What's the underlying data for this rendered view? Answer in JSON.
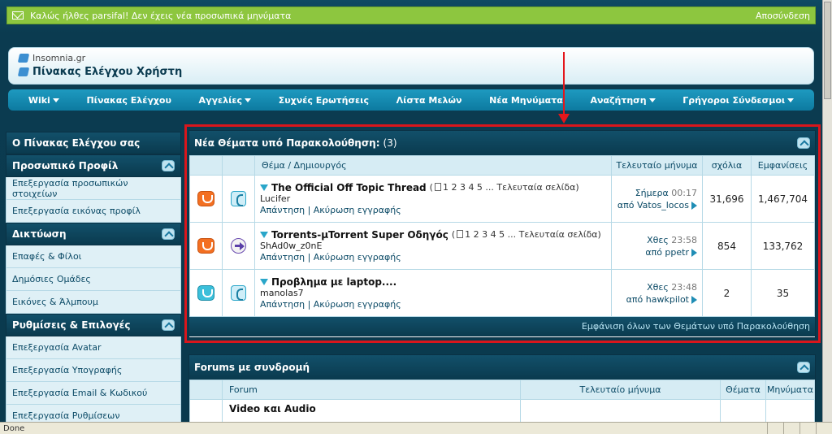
{
  "notice": {
    "message": "Καλώς ήλθες parsifal! Δεν έχεις νέα προσωπικά μηνύματα",
    "logout": "Αποσύνδεση"
  },
  "header": {
    "site": "Insomnia.gr",
    "title": "Πίνακας Ελέγχου Χρήστη"
  },
  "nav": [
    "Wiki",
    "Πίνακας Ελέγχου",
    "Αγγελίες",
    "Συχνές Ερωτήσεις",
    "Λίστα Μελών",
    "Νέα Μηνύματα",
    "Αναζήτηση",
    "Γρήγοροι Σύνδεσμοι"
  ],
  "sidebar": {
    "title": "Ο Πίνακας Ελέγχου σας",
    "sections": [
      {
        "title": "Προσωπικό Προφίλ",
        "items": [
          "Επεξεργασία προσωπικών στοιχείων",
          "Επεξεργασία εικόνας προφίλ"
        ]
      },
      {
        "title": "Δικτύωση",
        "items": [
          "Επαφές & Φίλοι",
          "Δημόσιες Ομάδες",
          "Εικόνες & Άλμπουμ"
        ]
      },
      {
        "title": "Ρυθμίσεις & Επιλογές",
        "items": [
          "Επεξεργασία Avatar",
          "Επεξεργασία Υπογραφής",
          "Επεξεργασία Email & Κωδικού",
          "Επεξεργασία Ρυθμίσεων"
        ]
      }
    ]
  },
  "subscribed": {
    "title": "Νέα Θέματα υπό Παρακολούθηση:",
    "count": "(3)",
    "columns": {
      "thread": "Θέμα / Δημιουργός",
      "last": "Τελευταίο μήνυμα",
      "replies": "σχόλια",
      "views": "Εμφανίσεις"
    },
    "threads": [
      {
        "title": "The Official Off Topic Thread",
        "pages_prefix": "(",
        "pages": "1 2 3 4 5 ... Τελευταία σελίδα)",
        "author": "Lucifer",
        "actions": "Απάντηση | Ακύρωση εγγραφής",
        "last_day": "Σήμερα",
        "last_time": "00:17",
        "last_by": "από Vatos_locos",
        "replies": "31,696",
        "views": "1,467,704"
      },
      {
        "title": "Torrents-µTorrent Super Οδηγός",
        "pages_prefix": "(",
        "pages": "1 2 3 4 5 ... Τελευταία σελίδα)",
        "author": "ShAd0w_z0nE",
        "actions": "Απάντηση | Ακύρωση εγγραφής",
        "last_day": "Χθες",
        "last_time": "23:58",
        "last_by": "από ppetr",
        "replies": "854",
        "views": "133,762"
      },
      {
        "title": "Προβλημα με laptop....",
        "pages_prefix": "",
        "pages": "",
        "author": "manolas7",
        "actions": "Απάντηση | Ακύρωση εγγραφής",
        "last_day": "Χθες",
        "last_time": "23:48",
        "last_by": "από hawkpilot",
        "replies": "2",
        "views": "35"
      }
    ],
    "footer": "Εμφάνιση όλων των Θεμάτων υπό Παρακολούθηση"
  },
  "forums": {
    "title": "Forums με συνδρομή",
    "columns": {
      "forum": "Forum",
      "last": "Τελευταίο μήνυμα",
      "threads": "Θέματα",
      "posts": "Μηνύματα"
    },
    "rows": [
      {
        "name": "Video και Audio"
      }
    ]
  },
  "status": {
    "text": "Done"
  }
}
